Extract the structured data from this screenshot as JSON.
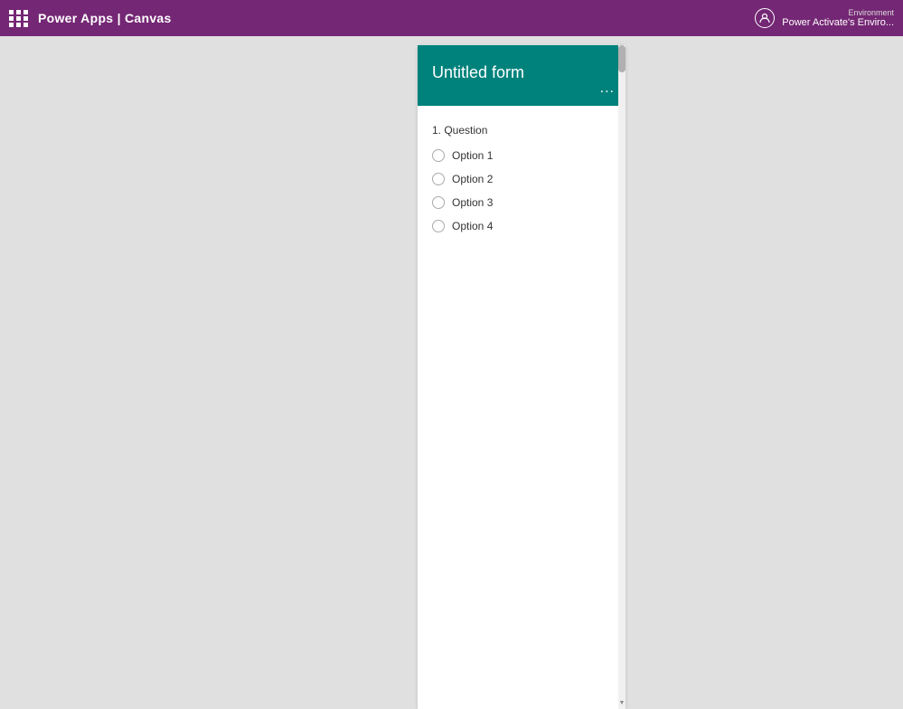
{
  "topbar": {
    "brand": "Power Apps  |  Canvas",
    "apps_icon": "apps-icon",
    "env_label": "Environment",
    "env_name": "Power Activate's Enviro..."
  },
  "form": {
    "title": "Untitled form",
    "menu_dots": "...",
    "question_label": "1. Question",
    "options": [
      {
        "label": "Option 1"
      },
      {
        "label": "Option 2"
      },
      {
        "label": "Option 3"
      },
      {
        "label": "Option 4"
      }
    ]
  }
}
